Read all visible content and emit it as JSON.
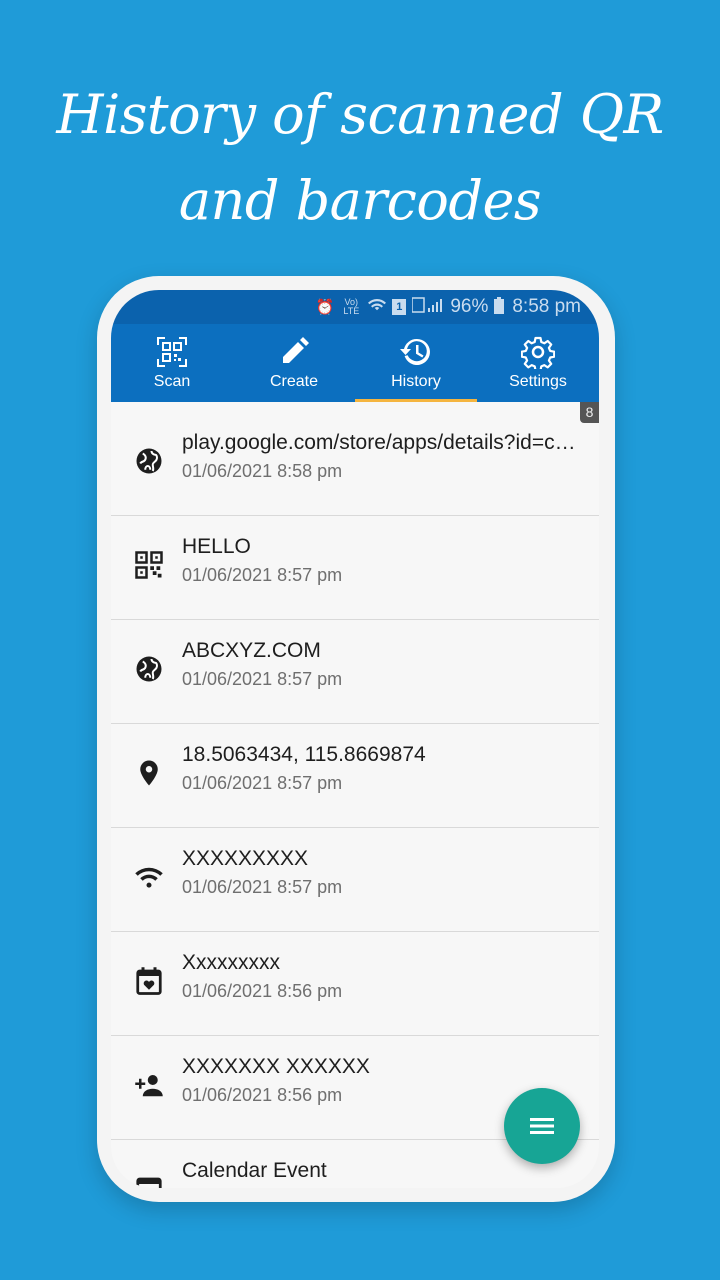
{
  "headline": {
    "line1": "History of scanned QR",
    "line2": "and barcodes"
  },
  "status_bar": {
    "signal_labels": "Vo) LTE",
    "sim_slot": "1",
    "battery": "96%",
    "time": "8:58 pm"
  },
  "tabs": [
    {
      "label": "Scan",
      "icon": "qr-code-icon"
    },
    {
      "label": "Create",
      "icon": "pencil-icon"
    },
    {
      "label": "History",
      "icon": "history-icon",
      "active": true
    },
    {
      "label": "Settings",
      "icon": "gear-icon"
    }
  ],
  "history": {
    "count": "8",
    "items": [
      {
        "icon": "globe-icon",
        "title": "play.google.com/store/apps/details?id=com",
        "date": "01/06/2021 8:58 pm"
      },
      {
        "icon": "qr-code-icon",
        "title": "HELLO",
        "date": "01/06/2021 8:57 pm"
      },
      {
        "icon": "globe-icon",
        "title": "ABCXYZ.COM",
        "date": "01/06/2021 8:57 pm"
      },
      {
        "icon": "location-pin-icon",
        "title": "18.5063434, 115.8669874",
        "date": "01/06/2021 8:57 pm"
      },
      {
        "icon": "wifi-icon",
        "title": "XXXXXXXXX",
        "date": "01/06/2021 8:57 pm"
      },
      {
        "icon": "calendar-heart-icon",
        "title": "Xxxxxxxxx",
        "date": "01/06/2021 8:56 pm"
      },
      {
        "icon": "add-contact-icon",
        "title": "XXXXXXX XXXXXX",
        "date": "01/06/2021 8:56 pm"
      },
      {
        "icon": "calendar-icon",
        "title": "Calendar Event",
        "date": ""
      }
    ]
  },
  "fab": {
    "icon": "menu-icon"
  },
  "colors": {
    "background": "#1f9bd8",
    "toolbar": "#0c6fbf",
    "tab_indicator": "#f5b53f",
    "fab": "#17a595"
  }
}
